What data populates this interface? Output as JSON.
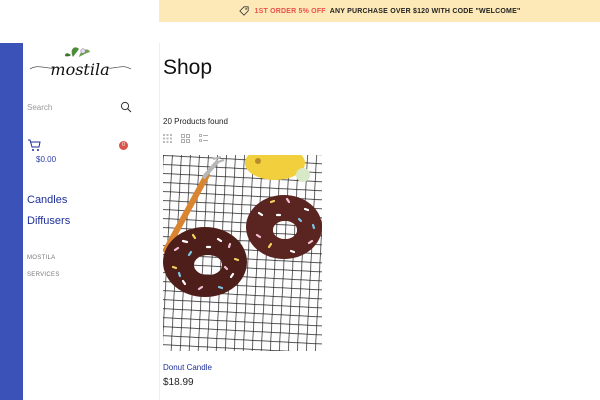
{
  "promo": {
    "highlight": "1ST ORDER 5% OFF",
    "text": "ANY PURCHASE OVER $120 WITH CODE \"WELCOME\""
  },
  "brand": {
    "logo_text": "mostila"
  },
  "search": {
    "placeholder": "Search"
  },
  "cart": {
    "amount": "$0.00",
    "count": "0"
  },
  "nav": {
    "main": [
      "Candles",
      "Diffusers"
    ],
    "secondary": [
      "MOSTILA",
      "SERVICES"
    ]
  },
  "page": {
    "title": "Shop",
    "count_text": "20 Products found"
  },
  "products": [
    {
      "name": "Donut Candle",
      "price": "$18.99"
    }
  ],
  "colors": {
    "accent": "#3b52b8",
    "link": "#1e2f9a",
    "promo_bg": "#fde9b8",
    "promo_highlight": "#e8524a"
  },
  "icons": {
    "promo": "tag-icon",
    "search": "search-icon",
    "cart": "cart-icon",
    "view_options": [
      "grid-4-icon",
      "grid-2-icon",
      "list-icon"
    ]
  }
}
